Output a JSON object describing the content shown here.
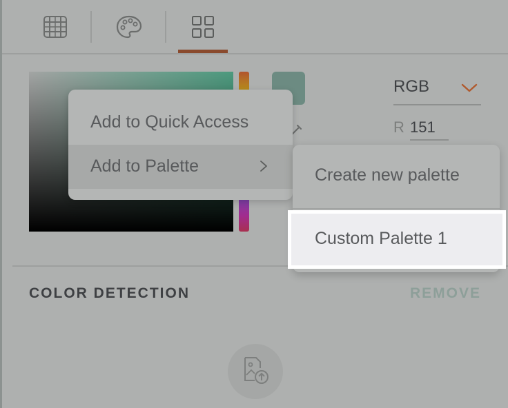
{
  "tabs": [
    {
      "icon": "grid-table-icon"
    },
    {
      "icon": "palette-icon"
    },
    {
      "icon": "four-squares-icon",
      "active": true
    }
  ],
  "picker": {
    "swatch_color": "#6c8b82",
    "mode": "RGB",
    "r_label": "R",
    "r_value": "151"
  },
  "context_menu": {
    "items": [
      {
        "label": "Add to Quick Access"
      },
      {
        "label": "Add to Palette",
        "has_submenu": true
      }
    ]
  },
  "submenu": {
    "items": [
      {
        "label": "Create new palette"
      },
      {
        "label": "Custom Palette 1",
        "highlighted": true
      }
    ]
  },
  "color_detection": {
    "title": "COLOR DETECTION",
    "remove_label": "REMOVE"
  },
  "colors": {
    "accent_underline": "#8a4a2d",
    "chevron": "#b05a2e"
  }
}
